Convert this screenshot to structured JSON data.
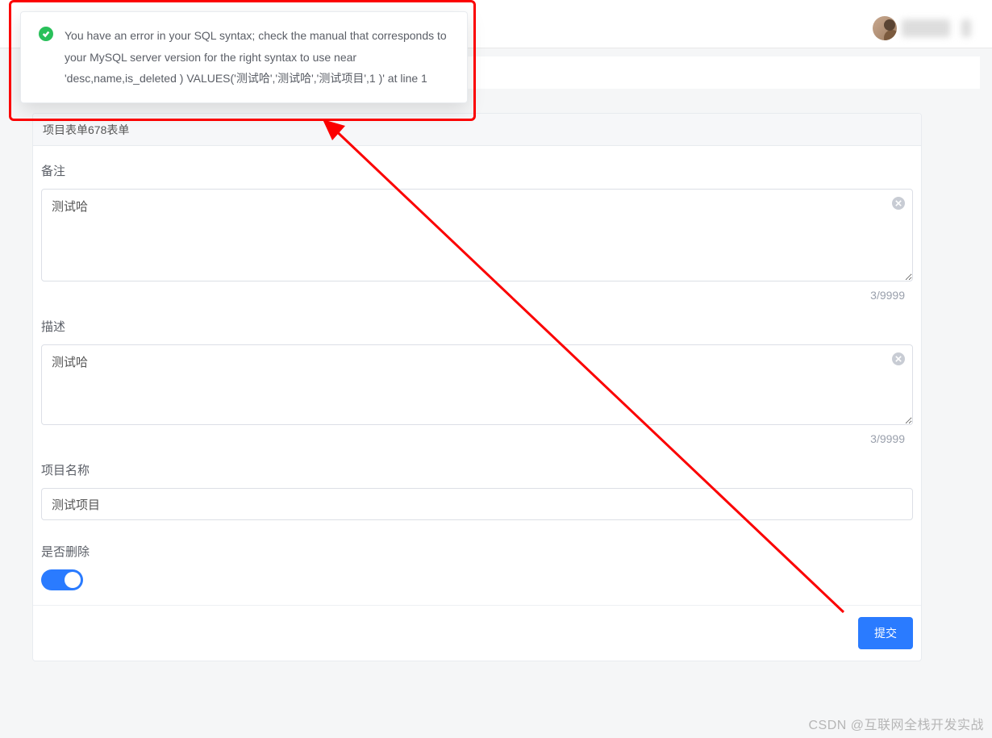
{
  "toast": {
    "message": "You have an error in your SQL syntax; check the manual that corresponds to your MySQL server version for the right syntax to use near 'desc,name,is_deleted ) VALUES('测试哈','测试哈','测试项目',1 )' at line 1"
  },
  "card": {
    "title": "项目表单678表单"
  },
  "fields": {
    "remark": {
      "label": "备注",
      "value": "测试哈",
      "counter": "3/9999"
    },
    "desc": {
      "label": "描述",
      "value": "测试哈",
      "counter": "3/9999"
    },
    "name": {
      "label": "项目名称",
      "value": "测试项目"
    },
    "isDeleted": {
      "label": "是否删除",
      "on": true
    }
  },
  "buttons": {
    "submit": "提交"
  },
  "watermark": "CSDN @互联网全栈开发实战"
}
